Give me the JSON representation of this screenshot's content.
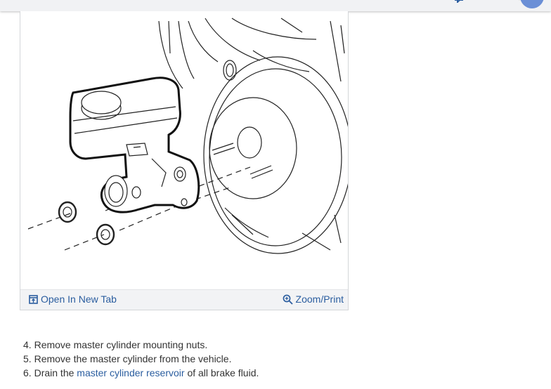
{
  "figure": {
    "open_tab_label": "Open In New Tab",
    "zoom_print_label": "Zoom/Print"
  },
  "steps": [
    {
      "number": "4.",
      "text": "Remove master cylinder mounting nuts."
    },
    {
      "number": "5.",
      "text": "Remove the master cylinder from the vehicle."
    },
    {
      "number": "6.",
      "pre": "Drain the",
      "link": "master cylinder reservoir",
      "post": "of all brake fluid."
    }
  ],
  "icons": {
    "open_tab": "open-in-new-tab-icon",
    "zoom": "magnifier-plus-icon",
    "cursor": "hand-pointer-icon"
  },
  "colors": {
    "link": "#2a5d9f",
    "footer_bg": "#f2f3f5",
    "topbar_bg": "#f1f2f4"
  }
}
